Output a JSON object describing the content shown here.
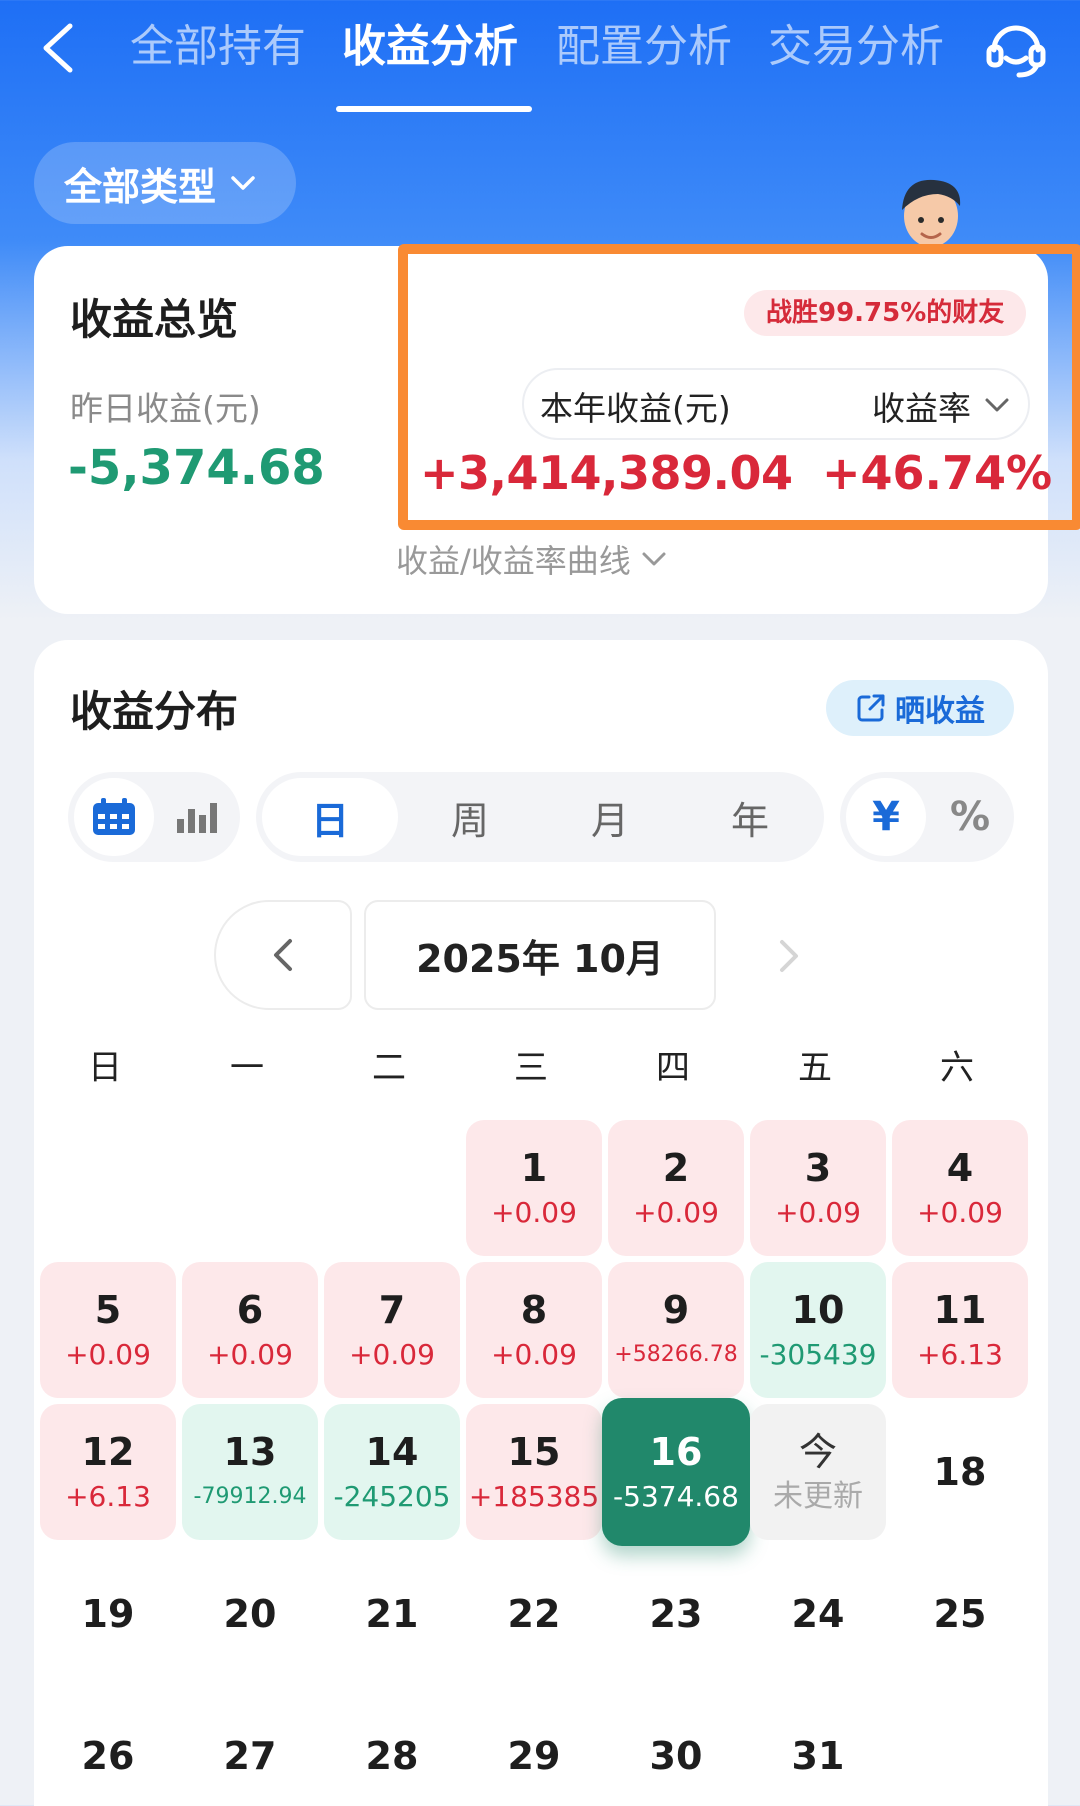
{
  "nav": {
    "tabs": [
      {
        "label": "全部持有",
        "active": false
      },
      {
        "label": "收益分析",
        "active": true
      },
      {
        "label": "配置分析",
        "active": false
      },
      {
        "label": "交易分析",
        "active": false
      }
    ],
    "back_icon": "chevron-left-icon",
    "service_icon": "customer-service-icon"
  },
  "filter": {
    "type_label": "全部类型"
  },
  "overview": {
    "title": "收益总览",
    "yesterday_label": "昨日收益(元)",
    "yesterday_value": "-5,374.68",
    "rank_badge": "战胜99.75%的财友",
    "year_label": "本年收益(元)",
    "year_value": "+3,414,389.04",
    "rate_label": "收益率",
    "rate_value": "+46.74%",
    "curve_toggle": "收益/收益率曲线"
  },
  "distribution": {
    "title": "收益分布",
    "share_label": "晒收益",
    "view_icons": [
      "calendar-icon",
      "bar-chart-icon"
    ],
    "periods": [
      "日",
      "周",
      "月",
      "年"
    ],
    "active_period": "日",
    "units": [
      "¥",
      "%"
    ],
    "active_unit": "¥",
    "month_label": "2025年 10月",
    "weekdays": [
      "日",
      "一",
      "二",
      "三",
      "四",
      "五",
      "六"
    ],
    "days": [
      {
        "num": "1",
        "amt": "+0.09",
        "kind": "pos"
      },
      {
        "num": "2",
        "amt": "+0.09",
        "kind": "pos"
      },
      {
        "num": "3",
        "amt": "+0.09",
        "kind": "pos"
      },
      {
        "num": "4",
        "amt": "+0.09",
        "kind": "pos"
      },
      {
        "num": "5",
        "amt": "+0.09",
        "kind": "pos"
      },
      {
        "num": "6",
        "amt": "+0.09",
        "kind": "pos"
      },
      {
        "num": "7",
        "amt": "+0.09",
        "kind": "pos"
      },
      {
        "num": "8",
        "amt": "+0.09",
        "kind": "pos"
      },
      {
        "num": "9",
        "amt": "+58266.78",
        "kind": "pos"
      },
      {
        "num": "10",
        "amt": "-305439",
        "kind": "neg"
      },
      {
        "num": "11",
        "amt": "+6.13",
        "kind": "pos"
      },
      {
        "num": "12",
        "amt": "+6.13",
        "kind": "pos"
      },
      {
        "num": "13",
        "amt": "-79912.94",
        "kind": "neg"
      },
      {
        "num": "14",
        "amt": "-245205",
        "kind": "neg"
      },
      {
        "num": "15",
        "amt": "+185385",
        "kind": "pos"
      },
      {
        "num": "16",
        "amt": "-5374.68",
        "kind": "sel"
      },
      {
        "num": "今",
        "amt": "未更新",
        "kind": "today"
      },
      {
        "num": "18",
        "amt": "",
        "kind": "plain"
      },
      {
        "num": "19",
        "amt": "",
        "kind": "plain"
      },
      {
        "num": "20",
        "amt": "",
        "kind": "plain"
      },
      {
        "num": "21",
        "amt": "",
        "kind": "plain"
      },
      {
        "num": "22",
        "amt": "",
        "kind": "plain"
      },
      {
        "num": "23",
        "amt": "",
        "kind": "plain"
      },
      {
        "num": "24",
        "amt": "",
        "kind": "plain"
      },
      {
        "num": "25",
        "amt": "",
        "kind": "plain"
      },
      {
        "num": "26",
        "amt": "",
        "kind": "plain"
      },
      {
        "num": "27",
        "amt": "",
        "kind": "plain"
      },
      {
        "num": "28",
        "amt": "",
        "kind": "plain"
      },
      {
        "num": "29",
        "amt": "",
        "kind": "plain"
      },
      {
        "num": "30",
        "amt": "",
        "kind": "plain"
      },
      {
        "num": "31",
        "amt": "",
        "kind": "plain"
      }
    ],
    "first_weekday_index": 3
  },
  "colors": {
    "brand_blue": "#1e6ff5",
    "gain_red": "#d9283a",
    "loss_green": "#1f9a73",
    "selected_green": "#21886b",
    "highlight_orange": "#f98a33"
  }
}
